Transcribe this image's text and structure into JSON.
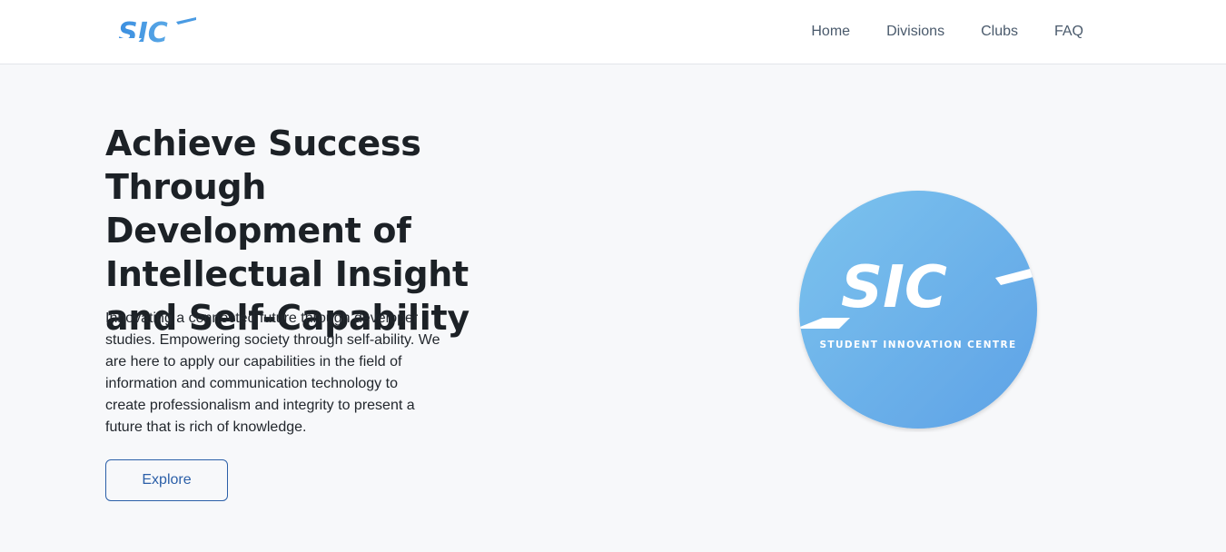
{
  "header": {
    "logo_text": "SIC",
    "nav": [
      {
        "label": "Home"
      },
      {
        "label": "Divisions"
      },
      {
        "label": "Clubs"
      },
      {
        "label": "FAQ"
      }
    ]
  },
  "hero": {
    "title": "Achieve Success Through Development of Intellectual Insight and Self-Capability",
    "description": "Innovating a connected future through developer studies. Empowering society through self-ability. We are here to apply our capabilities in the field of information and communication technology to create professionalism and integrity to present a future that is rich of knowledge.",
    "cta_label": "Explore"
  },
  "emblem": {
    "letters": "SIC",
    "subtitle": "STUDENT INNOVATION CENTRE"
  },
  "colors": {
    "brand_blue": "#5aa8e6",
    "accent_link": "#2b5fa8",
    "background": "#f7f8fa"
  }
}
